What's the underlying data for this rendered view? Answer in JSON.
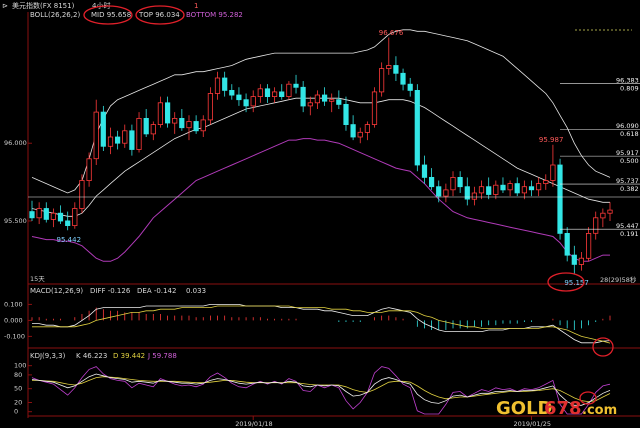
{
  "window": {
    "title": "美元指数(FX 8151)",
    "period": "4小时",
    "mid_text": "1",
    "mid_badge": "1"
  },
  "boll": {
    "label": "BOLL(26,26,2)",
    "mid_label": "MID 95.658",
    "top_label": "TOP 96.034",
    "bottom_label": "BOTTOM 95.282"
  },
  "price_axis": {
    "ticks": [
      {
        "label": "96.000",
        "value": 96.0
      },
      {
        "label": "95.500",
        "value": 95.5
      }
    ],
    "range": [
      95.12,
      96.78
    ]
  },
  "annotations": {
    "high": {
      "label": "96.676",
      "value": 96.676
    },
    "mid_high": {
      "label": "95.987",
      "value": 95.987
    },
    "low_left": {
      "label": "95.442",
      "value": 95.442
    },
    "low_right": {
      "label": "95.157",
      "value": 95.157
    },
    "count_label": "15天",
    "date_right_label": "28(29)58秒"
  },
  "fib_levels": [
    {
      "price": "96.383",
      "ratio": "0.809",
      "value": 96.383
    },
    {
      "price": "96.090",
      "ratio": "0.618",
      "value": 96.09
    },
    {
      "price": "95.917",
      "ratio": "0.500",
      "value": 95.917
    },
    {
      "price": "95.737",
      "ratio": "0.382",
      "value": 95.737
    },
    {
      "price": "95.447",
      "ratio": "0.191",
      "value": 95.447
    }
  ],
  "macd": {
    "label": "MACD(12,26,9)",
    "diff_label": "DIFF -0.126",
    "dea_label": "DEA -0.142",
    "macd_value": "0.033",
    "ticks": [
      {
        "label": "0.100",
        "value": 0.1
      },
      {
        "label": "0.000",
        "value": 0.0
      },
      {
        "label": "-0.100",
        "value": -0.1
      }
    ],
    "range": [
      -0.16,
      0.14
    ]
  },
  "kdj": {
    "label": "KDJ(9,3,3)",
    "k_label": "K 46.223",
    "d_label": "D 39.442",
    "j_label": "J 59.788",
    "ticks": [
      {
        "label": "100",
        "value": 100
      },
      {
        "label": "80",
        "value": 80
      },
      {
        "label": "50",
        "value": 50
      },
      {
        "label": "20",
        "value": 20
      },
      {
        "label": "0",
        "value": 0
      }
    ],
    "range": [
      -5,
      108
    ]
  },
  "x_axis": {
    "dates": [
      {
        "label": "2019/01/18",
        "index": 31
      },
      {
        "label": "2019/01/25",
        "index": 70
      }
    ]
  },
  "watermark": {
    "text_a": "GOLD",
    "text_b": "678",
    "text_c": ".com"
  },
  "colors": {
    "up": "#ff3a3a",
    "down": "#33e6e6",
    "boll_bottom": "#b03ab8",
    "ellipse": "#e0202a"
  },
  "chart_data": {
    "type": "candlestick",
    "title": "美元指数(FX 8151)",
    "period": "4小时",
    "candles": [
      {
        "o": 95.56,
        "h": 95.63,
        "l": 95.5,
        "c": 95.52
      },
      {
        "o": 95.52,
        "h": 95.62,
        "l": 95.48,
        "c": 95.58
      },
      {
        "o": 95.58,
        "h": 95.62,
        "l": 95.49,
        "c": 95.51
      },
      {
        "o": 95.51,
        "h": 95.58,
        "l": 95.46,
        "c": 95.55
      },
      {
        "o": 95.55,
        "h": 95.6,
        "l": 95.48,
        "c": 95.5
      },
      {
        "o": 95.5,
        "h": 95.56,
        "l": 95.44,
        "c": 95.47
      },
      {
        "o": 95.47,
        "h": 95.62,
        "l": 95.45,
        "c": 95.58
      },
      {
        "o": 95.58,
        "h": 95.8,
        "l": 95.55,
        "c": 95.76
      },
      {
        "o": 95.76,
        "h": 95.94,
        "l": 95.72,
        "c": 95.9
      },
      {
        "o": 95.9,
        "h": 96.28,
        "l": 95.86,
        "c": 96.2
      },
      {
        "o": 96.2,
        "h": 96.24,
        "l": 95.95,
        "c": 95.98
      },
      {
        "o": 95.98,
        "h": 96.1,
        "l": 95.93,
        "c": 96.04
      },
      {
        "o": 96.04,
        "h": 96.08,
        "l": 95.96,
        "c": 96.0
      },
      {
        "o": 96.0,
        "h": 96.12,
        "l": 95.97,
        "c": 96.08
      },
      {
        "o": 96.08,
        "h": 96.12,
        "l": 95.92,
        "c": 95.96
      },
      {
        "o": 95.96,
        "h": 96.2,
        "l": 95.94,
        "c": 96.16
      },
      {
        "o": 96.16,
        "h": 96.22,
        "l": 96.04,
        "c": 96.06
      },
      {
        "o": 96.06,
        "h": 96.14,
        "l": 96.02,
        "c": 96.12
      },
      {
        "o": 96.12,
        "h": 96.3,
        "l": 96.1,
        "c": 96.26
      },
      {
        "o": 96.26,
        "h": 96.3,
        "l": 96.1,
        "c": 96.13
      },
      {
        "o": 96.13,
        "h": 96.2,
        "l": 96.06,
        "c": 96.16
      },
      {
        "o": 96.16,
        "h": 96.22,
        "l": 96.08,
        "c": 96.1
      },
      {
        "o": 96.1,
        "h": 96.18,
        "l": 96.02,
        "c": 96.14
      },
      {
        "o": 96.14,
        "h": 96.18,
        "l": 96.06,
        "c": 96.08
      },
      {
        "o": 96.08,
        "h": 96.18,
        "l": 96.04,
        "c": 96.15
      },
      {
        "o": 96.15,
        "h": 96.36,
        "l": 96.12,
        "c": 96.32
      },
      {
        "o": 96.32,
        "h": 96.46,
        "l": 96.28,
        "c": 96.42
      },
      {
        "o": 96.42,
        "h": 96.46,
        "l": 96.3,
        "c": 96.34
      },
      {
        "o": 96.34,
        "h": 96.38,
        "l": 96.28,
        "c": 96.31
      },
      {
        "o": 96.31,
        "h": 96.36,
        "l": 96.24,
        "c": 96.28
      },
      {
        "o": 96.28,
        "h": 96.32,
        "l": 96.2,
        "c": 96.24
      },
      {
        "o": 96.24,
        "h": 96.34,
        "l": 96.2,
        "c": 96.3
      },
      {
        "o": 96.3,
        "h": 96.38,
        "l": 96.26,
        "c": 96.35
      },
      {
        "o": 96.35,
        "h": 96.38,
        "l": 96.26,
        "c": 96.3
      },
      {
        "o": 96.3,
        "h": 96.36,
        "l": 96.26,
        "c": 96.33
      },
      {
        "o": 96.33,
        "h": 96.38,
        "l": 96.28,
        "c": 96.3
      },
      {
        "o": 96.3,
        "h": 96.4,
        "l": 96.28,
        "c": 96.38
      },
      {
        "o": 96.38,
        "h": 96.44,
        "l": 96.32,
        "c": 96.36
      },
      {
        "o": 96.36,
        "h": 96.4,
        "l": 96.2,
        "c": 96.24
      },
      {
        "o": 96.24,
        "h": 96.3,
        "l": 96.18,
        "c": 96.26
      },
      {
        "o": 96.26,
        "h": 96.34,
        "l": 96.22,
        "c": 96.31
      },
      {
        "o": 96.31,
        "h": 96.36,
        "l": 96.24,
        "c": 96.27
      },
      {
        "o": 96.27,
        "h": 96.32,
        "l": 96.2,
        "c": 96.28
      },
      {
        "o": 96.28,
        "h": 96.34,
        "l": 96.22,
        "c": 96.25
      },
      {
        "o": 96.25,
        "h": 96.3,
        "l": 96.08,
        "c": 96.12
      },
      {
        "o": 96.12,
        "h": 96.18,
        "l": 96.02,
        "c": 96.04
      },
      {
        "o": 96.04,
        "h": 96.1,
        "l": 96.0,
        "c": 96.07
      },
      {
        "o": 96.07,
        "h": 96.14,
        "l": 96.02,
        "c": 96.12
      },
      {
        "o": 96.12,
        "h": 96.36,
        "l": 96.1,
        "c": 96.33
      },
      {
        "o": 96.33,
        "h": 96.52,
        "l": 96.3,
        "c": 96.48
      },
      {
        "o": 96.48,
        "h": 96.68,
        "l": 96.44,
        "c": 96.5
      },
      {
        "o": 96.5,
        "h": 96.56,
        "l": 96.4,
        "c": 96.45
      },
      {
        "o": 96.45,
        "h": 96.48,
        "l": 96.34,
        "c": 96.38
      },
      {
        "o": 96.38,
        "h": 96.42,
        "l": 96.3,
        "c": 96.34
      },
      {
        "o": 96.34,
        "h": 96.38,
        "l": 95.82,
        "c": 95.86
      },
      {
        "o": 95.86,
        "h": 95.92,
        "l": 95.74,
        "c": 95.78
      },
      {
        "o": 95.78,
        "h": 95.84,
        "l": 95.7,
        "c": 95.72
      },
      {
        "o": 95.72,
        "h": 95.76,
        "l": 95.62,
        "c": 95.66
      },
      {
        "o": 95.66,
        "h": 95.74,
        "l": 95.62,
        "c": 95.7
      },
      {
        "o": 95.7,
        "h": 95.82,
        "l": 95.66,
        "c": 95.78
      },
      {
        "o": 95.78,
        "h": 95.82,
        "l": 95.68,
        "c": 95.72
      },
      {
        "o": 95.72,
        "h": 95.78,
        "l": 95.6,
        "c": 95.64
      },
      {
        "o": 95.64,
        "h": 95.72,
        "l": 95.6,
        "c": 95.68
      },
      {
        "o": 95.68,
        "h": 95.76,
        "l": 95.64,
        "c": 95.72
      },
      {
        "o": 95.72,
        "h": 95.78,
        "l": 95.64,
        "c": 95.67
      },
      {
        "o": 95.67,
        "h": 95.76,
        "l": 95.64,
        "c": 95.73
      },
      {
        "o": 95.73,
        "h": 95.78,
        "l": 95.68,
        "c": 95.7
      },
      {
        "o": 95.7,
        "h": 95.76,
        "l": 95.66,
        "c": 95.74
      },
      {
        "o": 95.74,
        "h": 95.78,
        "l": 95.66,
        "c": 95.68
      },
      {
        "o": 95.68,
        "h": 95.76,
        "l": 95.64,
        "c": 95.72
      },
      {
        "o": 95.72,
        "h": 95.76,
        "l": 95.66,
        "c": 95.7
      },
      {
        "o": 95.7,
        "h": 95.78,
        "l": 95.66,
        "c": 95.74
      },
      {
        "o": 95.74,
        "h": 95.8,
        "l": 95.7,
        "c": 95.76
      },
      {
        "o": 95.76,
        "h": 95.99,
        "l": 95.72,
        "c": 95.86
      },
      {
        "o": 95.86,
        "h": 95.9,
        "l": 95.38,
        "c": 95.42
      },
      {
        "o": 95.42,
        "h": 95.46,
        "l": 95.24,
        "c": 95.28
      },
      {
        "o": 95.28,
        "h": 95.34,
        "l": 95.16,
        "c": 95.22
      },
      {
        "o": 95.22,
        "h": 95.3,
        "l": 95.18,
        "c": 95.26
      },
      {
        "o": 95.26,
        "h": 95.46,
        "l": 95.24,
        "c": 95.42
      },
      {
        "o": 95.42,
        "h": 95.56,
        "l": 95.38,
        "c": 95.52
      },
      {
        "o": 95.52,
        "h": 95.58,
        "l": 95.46,
        "c": 95.55
      },
      {
        "o": 95.55,
        "h": 95.62,
        "l": 95.5,
        "c": 95.57
      }
    ],
    "boll_top": [
      95.78,
      95.76,
      95.74,
      95.72,
      95.7,
      95.68,
      95.7,
      95.76,
      95.9,
      96.06,
      96.16,
      96.24,
      96.28,
      96.3,
      96.32,
      96.34,
      96.36,
      96.38,
      96.4,
      96.42,
      96.44,
      96.44,
      96.45,
      96.46,
      96.46,
      96.47,
      96.48,
      96.49,
      96.5,
      96.52,
      96.54,
      96.55,
      96.56,
      96.57,
      96.58,
      96.58,
      96.58,
      96.58,
      96.58,
      96.58,
      96.58,
      96.58,
      96.58,
      96.58,
      96.58,
      96.58,
      96.59,
      96.6,
      96.62,
      96.66,
      96.7,
      96.72,
      96.73,
      96.73,
      96.72,
      96.72,
      96.71,
      96.7,
      96.69,
      96.68,
      96.67,
      96.66,
      96.64,
      96.62,
      96.6,
      96.58,
      96.56,
      96.52,
      96.48,
      96.44,
      96.4,
      96.36,
      96.32,
      96.26,
      96.18,
      96.1,
      96.0,
      95.92,
      95.86,
      95.82,
      95.8,
      95.78
    ],
    "boll_mid": [
      95.58,
      95.57,
      95.56,
      95.55,
      95.54,
      95.53,
      95.53,
      95.55,
      95.6,
      95.66,
      95.7,
      95.74,
      95.78,
      95.82,
      95.85,
      95.88,
      95.91,
      95.94,
      95.97,
      96.0,
      96.03,
      96.05,
      96.07,
      96.09,
      96.1,
      96.12,
      96.14,
      96.16,
      96.18,
      96.2,
      96.22,
      96.23,
      96.24,
      96.25,
      96.26,
      96.27,
      96.28,
      96.29,
      96.29,
      96.29,
      96.29,
      96.29,
      96.29,
      96.29,
      96.28,
      96.27,
      96.26,
      96.26,
      96.26,
      96.27,
      96.28,
      96.28,
      96.28,
      96.27,
      96.25,
      96.23,
      96.2,
      96.17,
      96.14,
      96.11,
      96.08,
      96.05,
      96.02,
      95.99,
      95.96,
      95.93,
      95.9,
      95.87,
      95.84,
      95.82,
      95.8,
      95.78,
      95.76,
      95.74,
      95.72,
      95.7,
      95.68,
      95.66,
      95.64,
      95.63,
      95.62,
      95.62
    ],
    "boll_bottom": [
      95.4,
      95.39,
      95.38,
      95.38,
      95.37,
      95.37,
      95.36,
      95.34,
      95.3,
      95.26,
      95.24,
      95.24,
      95.26,
      95.3,
      95.35,
      95.4,
      95.46,
      95.52,
      95.56,
      95.6,
      95.64,
      95.68,
      95.72,
      95.76,
      95.78,
      95.8,
      95.82,
      95.84,
      95.86,
      95.88,
      95.9,
      95.92,
      95.94,
      95.96,
      95.98,
      96.0,
      96.02,
      96.02,
      96.03,
      96.03,
      96.02,
      96.02,
      96.01,
      96.0,
      95.98,
      95.96,
      95.94,
      95.92,
      95.9,
      95.88,
      95.86,
      95.84,
      95.83,
      95.82,
      95.78,
      95.74,
      95.69,
      95.64,
      95.6,
      95.56,
      95.54,
      95.52,
      95.51,
      95.5,
      95.49,
      95.48,
      95.47,
      95.46,
      95.45,
      95.44,
      95.43,
      95.42,
      95.41,
      95.4,
      95.36,
      95.3,
      95.26,
      95.24,
      95.24,
      95.26,
      95.28,
      95.28
    ],
    "macd_hist": [
      0.02,
      0.02,
      0.01,
      0.01,
      0.01,
      0.0,
      0.02,
      0.04,
      0.06,
      0.08,
      0.07,
      0.06,
      0.06,
      0.05,
      0.05,
      0.05,
      0.04,
      0.04,
      0.04,
      0.03,
      0.03,
      0.03,
      0.03,
      0.02,
      0.02,
      0.03,
      0.03,
      0.03,
      0.02,
      0.02,
      0.02,
      0.02,
      0.02,
      0.01,
      0.01,
      0.01,
      0.01,
      0.01,
      0.0,
      0.0,
      0.0,
      0.0,
      0.0,
      -0.01,
      -0.01,
      -0.01,
      -0.01,
      0.0,
      0.02,
      0.03,
      0.03,
      0.02,
      0.01,
      0.0,
      -0.04,
      -0.05,
      -0.06,
      -0.06,
      -0.06,
      -0.05,
      -0.05,
      -0.05,
      -0.04,
      -0.04,
      -0.03,
      -0.03,
      -0.02,
      -0.02,
      -0.02,
      -0.01,
      -0.01,
      0.0,
      0.0,
      0.01,
      -0.03,
      -0.05,
      -0.06,
      -0.05,
      -0.03,
      -0.01,
      0.01,
      0.03
    ],
    "diff": [
      -0.02,
      -0.02,
      -0.03,
      -0.03,
      -0.04,
      -0.04,
      -0.03,
      0.0,
      0.03,
      0.07,
      0.08,
      0.08,
      0.08,
      0.08,
      0.08,
      0.08,
      0.09,
      0.09,
      0.09,
      0.09,
      0.09,
      0.09,
      0.09,
      0.09,
      0.09,
      0.1,
      0.1,
      0.1,
      0.1,
      0.1,
      0.09,
      0.09,
      0.09,
      0.09,
      0.09,
      0.08,
      0.08,
      0.08,
      0.07,
      0.07,
      0.07,
      0.06,
      0.06,
      0.05,
      0.04,
      0.03,
      0.03,
      0.03,
      0.05,
      0.07,
      0.08,
      0.07,
      0.06,
      0.05,
      0.01,
      -0.02,
      -0.04,
      -0.06,
      -0.07,
      -0.07,
      -0.07,
      -0.07,
      -0.07,
      -0.07,
      -0.06,
      -0.06,
      -0.06,
      -0.05,
      -0.05,
      -0.05,
      -0.04,
      -0.04,
      -0.04,
      -0.03,
      -0.06,
      -0.09,
      -0.12,
      -0.14,
      -0.14,
      -0.14,
      -0.13,
      -0.126
    ],
    "dea": [
      -0.04,
      -0.04,
      -0.04,
      -0.04,
      -0.04,
      -0.04,
      -0.04,
      -0.03,
      -0.02,
      0.0,
      0.01,
      0.02,
      0.03,
      0.04,
      0.05,
      0.05,
      0.06,
      0.06,
      0.07,
      0.07,
      0.07,
      0.08,
      0.08,
      0.08,
      0.08,
      0.08,
      0.09,
      0.09,
      0.09,
      0.09,
      0.09,
      0.09,
      0.09,
      0.09,
      0.09,
      0.09,
      0.09,
      0.08,
      0.08,
      0.08,
      0.08,
      0.08,
      0.07,
      0.07,
      0.07,
      0.06,
      0.06,
      0.05,
      0.05,
      0.05,
      0.06,
      0.06,
      0.06,
      0.06,
      0.05,
      0.03,
      0.02,
      0.0,
      -0.01,
      -0.02,
      -0.03,
      -0.04,
      -0.04,
      -0.05,
      -0.05,
      -0.05,
      -0.05,
      -0.05,
      -0.05,
      -0.05,
      -0.05,
      -0.05,
      -0.04,
      -0.04,
      -0.05,
      -0.06,
      -0.08,
      -0.1,
      -0.11,
      -0.12,
      -0.13,
      -0.142
    ],
    "kdj_k": [
      70,
      68,
      66,
      64,
      58,
      52,
      56,
      66,
      76,
      82,
      78,
      74,
      72,
      70,
      64,
      66,
      64,
      62,
      68,
      66,
      64,
      62,
      62,
      60,
      62,
      68,
      72,
      70,
      66,
      62,
      60,
      62,
      64,
      62,
      64,
      62,
      66,
      64,
      56,
      54,
      58,
      56,
      58,
      56,
      44,
      34,
      36,
      42,
      60,
      70,
      74,
      70,
      64,
      60,
      38,
      26,
      20,
      18,
      24,
      34,
      36,
      32,
      36,
      40,
      40,
      44,
      44,
      46,
      44,
      46,
      46,
      48,
      52,
      56,
      36,
      22,
      14,
      14,
      20,
      30,
      40,
      46.223
    ],
    "kdj_d": [
      68,
      68,
      67,
      66,
      63,
      60,
      58,
      62,
      68,
      74,
      76,
      75,
      74,
      72,
      70,
      68,
      67,
      66,
      66,
      66,
      66,
      65,
      64,
      63,
      63,
      64,
      66,
      68,
      68,
      66,
      64,
      63,
      63,
      63,
      63,
      63,
      63,
      63,
      61,
      59,
      58,
      58,
      58,
      58,
      54,
      48,
      44,
      42,
      48,
      56,
      64,
      66,
      66,
      64,
      56,
      46,
      38,
      32,
      28,
      30,
      32,
      32,
      34,
      36,
      38,
      40,
      42,
      44,
      44,
      44,
      45,
      46,
      48,
      50,
      46,
      38,
      30,
      24,
      22,
      24,
      32,
      39.442
    ],
    "kdj_j": [
      74,
      68,
      64,
      60,
      48,
      36,
      52,
      74,
      92,
      98,
      82,
      72,
      68,
      66,
      52,
      62,
      58,
      54,
      72,
      66,
      60,
      56,
      58,
      54,
      60,
      76,
      84,
      74,
      62,
      54,
      52,
      60,
      66,
      60,
      66,
      60,
      72,
      66,
      46,
      44,
      58,
      52,
      58,
      52,
      24,
      6,
      20,
      42,
      84,
      98,
      94,
      78,
      60,
      52,
      2,
      -5,
      -5,
      -5,
      16,
      42,
      44,
      32,
      40,
      48,
      44,
      52,
      48,
      50,
      44,
      50,
      48,
      52,
      60,
      68,
      16,
      -5,
      -5,
      -5,
      16,
      42,
      56,
      59.788
    ]
  }
}
